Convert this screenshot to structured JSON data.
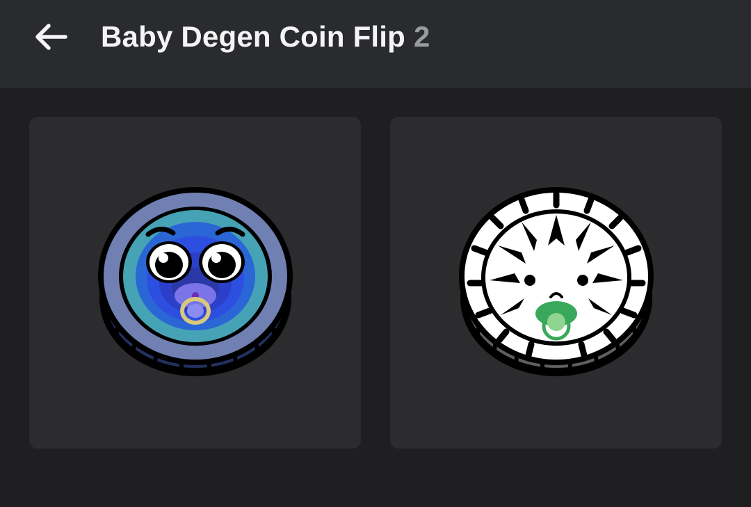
{
  "header": {
    "back_icon": "arrow-left-icon",
    "title": "Baby Degen Coin Flip",
    "count": "2"
  },
  "items": [
    {
      "name": "blue-baby-coin-icon",
      "colors": {
        "rim": "#6c7bb0",
        "face": "#2f4fd9",
        "edge": "#24346f",
        "pacifier": "#d9c97a"
      }
    },
    {
      "name": "zebra-baby-coin-icon",
      "colors": {
        "rim": "#ffffff",
        "face": "#ffffff",
        "edge": "#6c6c6c",
        "pacifier": "#6cc56f"
      }
    }
  ],
  "colors": {
    "background": "#1f1f21",
    "header": "#2a2b2f",
    "card": "#2c2c2e",
    "title_text": "#f4f4f5",
    "count_text": "#9a9ba0"
  }
}
